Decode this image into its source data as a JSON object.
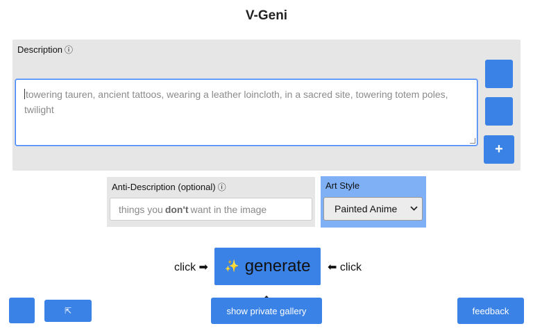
{
  "app": {
    "title": "V-Geni"
  },
  "description": {
    "label": "Description",
    "info_glyph": "ⓘ",
    "icon": "image-icon",
    "placeholder": "towering tauren, ancient tattoos, wearing a leather loincloth, in a sacred site, towering totem poles, twilight",
    "side_buttons": [
      {
        "icon": "dice-icon",
        "glyph": ""
      },
      {
        "icon": "history-icon",
        "glyph": ""
      },
      {
        "icon": "plus-icon",
        "glyph": "+"
      }
    ]
  },
  "anti_description": {
    "label": "Anti-Description (optional)",
    "info_glyph": "ⓘ",
    "icon": "ban-icon",
    "placeholder_pre": "things you",
    "placeholder_bold": "don't",
    "placeholder_post": "want in the image"
  },
  "art_style": {
    "label": "Art Style",
    "icon": "palette-icon",
    "selected": "Painted Anime"
  },
  "generate": {
    "hint_left": "click ➡",
    "hint_right": "⬅ click",
    "sparkle": "✨",
    "label": "generate"
  },
  "bottom_bar": {
    "left_icon": "settings-icon",
    "left_glyph": "",
    "top_icon": "arrow-up-left-icon",
    "top_glyph": "⇱",
    "gallery_label": " show private gallery",
    "feedback_label": " feedback"
  },
  "colors": {
    "accent": "#3b82e6",
    "panel_bg": "#e6e6e6",
    "style_panel_bg": "#7fb0f5"
  }
}
